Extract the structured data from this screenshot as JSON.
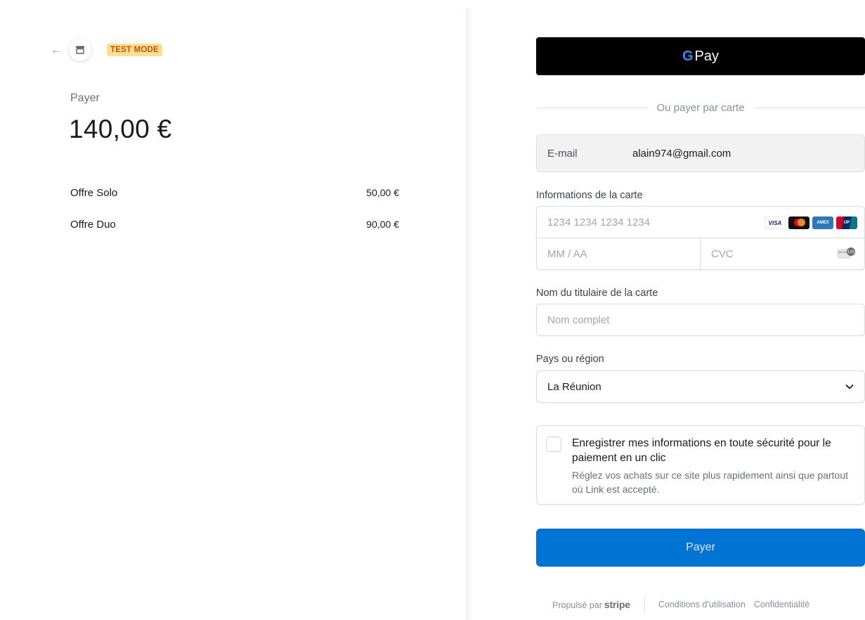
{
  "summary": {
    "test_mode": "TEST MODE",
    "pay_label": "Payer",
    "total": "140,00 €",
    "items": [
      {
        "name": "Offre Solo",
        "price": "50,00 €"
      },
      {
        "name": "Offre Duo",
        "price": "90,00 €"
      }
    ]
  },
  "checkout": {
    "gpay_g": "G",
    "gpay_text": "Pay",
    "divider_text": "Ou payer par carte",
    "email_label": "E-mail",
    "email_value": "alain974@gmail.com",
    "card_label": "Informations de la carte",
    "card_number_placeholder": "1234 1234 1234 1234",
    "expiry_placeholder": "MM / AA",
    "cvc_placeholder": "CVC",
    "card_brands": [
      "VISA",
      "Mastercard",
      "American Express",
      "UnionPay"
    ],
    "holder_label": "Nom du titulaire de la carte",
    "holder_placeholder": "Nom complet",
    "country_label": "Pays ou région",
    "country_value": "La Réunion",
    "link_title": "Enregistrer mes informations en toute sécurité pour le paiement en un clic",
    "link_desc": "Réglez vos achats sur ce site plus rapidement ainsi que partout où Link est accepté.",
    "pay_button": "Payer",
    "footer": {
      "powered_by": "Propulsé par",
      "brand": "stripe",
      "terms": "Conditions d'utilisation",
      "privacy": "Confidentialité"
    }
  },
  "colors": {
    "accent": "#0074d4",
    "test_badge_bg": "#ffde92",
    "test_badge_text": "#bb5504"
  }
}
